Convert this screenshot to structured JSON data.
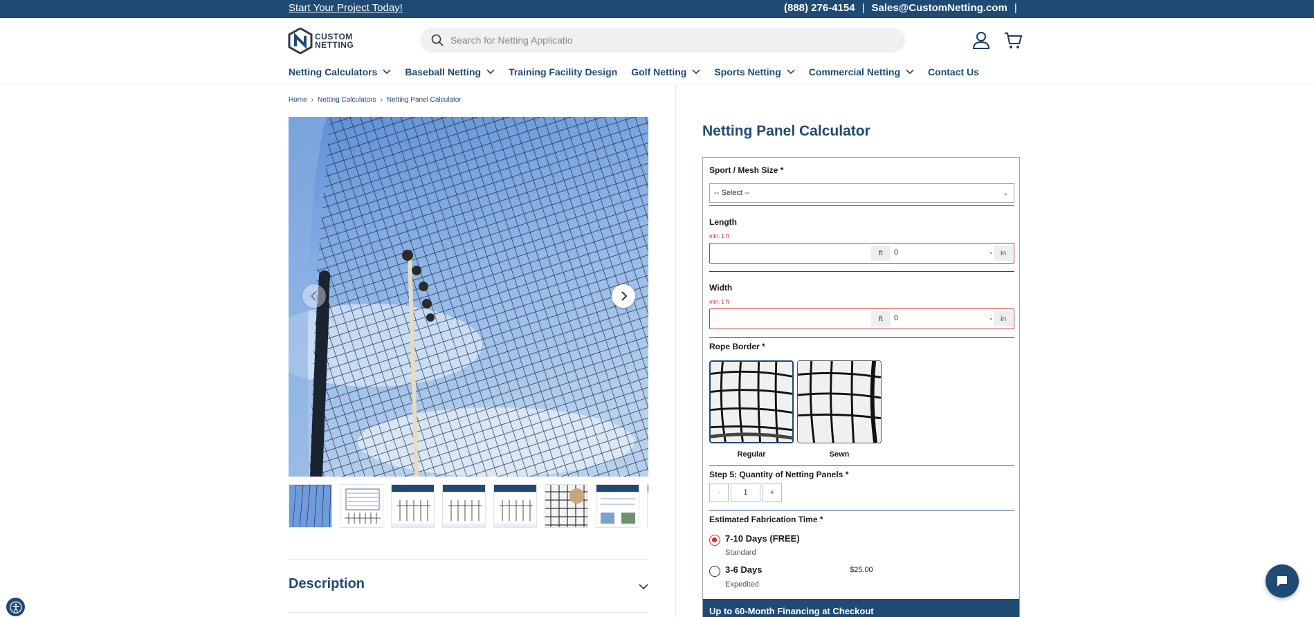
{
  "topbar": {
    "promo": "Start Your Project Today!",
    "phone": "(888) 276-4154",
    "email": "Sales@CustomNetting.com",
    "separator": "|"
  },
  "logo": {
    "line1": "CUSTOM",
    "line2": "NETTING"
  },
  "search": {
    "placeholder": "Search for Netting Applicatio"
  },
  "icons": {
    "search": "search-icon",
    "account": "user-icon",
    "cart": "cart-icon"
  },
  "nav": {
    "items": [
      {
        "label": "Netting Calculators",
        "dropdown": true
      },
      {
        "label": "Baseball Netting",
        "dropdown": true
      },
      {
        "label": "Training Facility Design",
        "dropdown": false
      },
      {
        "label": "Golf Netting",
        "dropdown": true
      },
      {
        "label": "Sports Netting",
        "dropdown": true
      },
      {
        "label": "Commercial Netting",
        "dropdown": true
      },
      {
        "label": "Contact Us",
        "dropdown": false
      }
    ]
  },
  "breadcrumb": [
    "Home",
    "Netting Calculators",
    "Netting Panel Calculator"
  ],
  "gallery": {
    "thumb_count": 8
  },
  "description": {
    "label": "Description"
  },
  "product": {
    "title": "Netting Panel Calculator"
  },
  "calculator": {
    "sport_label": "Sport / Mesh Size *",
    "sport_value": "-- Select --",
    "length_label": "Length",
    "length_min": "min: 1 ft",
    "width_label": "Width",
    "width_min": "min: 1 ft",
    "unit_ft": "ft",
    "unit_in": "in",
    "inches_value": "0",
    "rope_label": "Rope Border *",
    "rope_options": [
      {
        "label": "Regular",
        "selected": true
      },
      {
        "label": "Sewn",
        "selected": false
      }
    ],
    "qty_label": "Step 5: Quantity of Netting Panels *",
    "qty_minus": "-",
    "qty_value": "1",
    "qty_plus": "+",
    "fab_label": "Estimated Fabrication Time *",
    "fab_options": [
      {
        "title": "7-10 Days (FREE)",
        "sub": "Standard",
        "price": "",
        "selected": true
      },
      {
        "title": "3-6 Days",
        "sub": "Expedited",
        "price": "$25.00",
        "selected": false
      }
    ],
    "financing": "Up to 60-Month Financing at Checkout"
  },
  "colors": {
    "brand": "#1f4a73",
    "error": "#d32a2a"
  }
}
